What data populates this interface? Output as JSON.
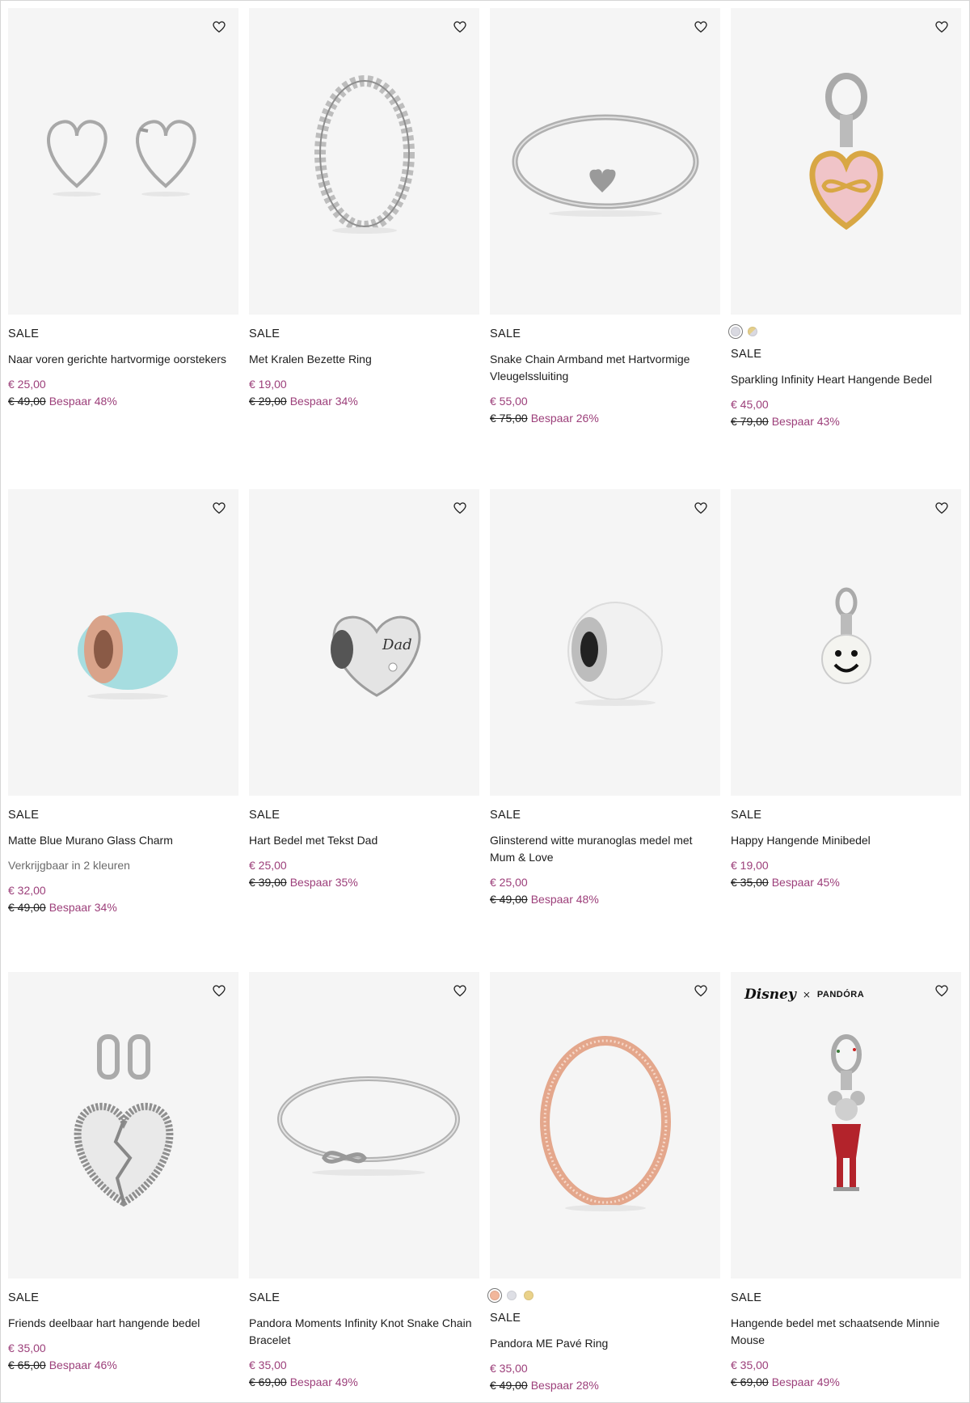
{
  "products": [
    {
      "badge": "SALE",
      "name": "Naar voren gerichte hartvormige oorstekers",
      "price": "€ 25,00",
      "old_price": "€ 49,00",
      "save": "Bespaar 48%",
      "icon": "heart-earrings"
    },
    {
      "badge": "SALE",
      "name": "Met Kralen Bezette Ring",
      "price": "€ 19,00",
      "old_price": "€ 29,00",
      "save": "Bespaar 34%",
      "icon": "beaded-ring"
    },
    {
      "badge": "SALE",
      "name": "Snake Chain Armband met Hartvormige Vleugelssluiting",
      "price": "€ 55,00",
      "old_price": "€ 75,00",
      "save": "Bespaar 26%",
      "icon": "snake-chain-bracelet"
    },
    {
      "badge": "SALE",
      "name": "Sparkling Infinity Heart Hangende Bedel",
      "price": "€ 45,00",
      "old_price": "€ 79,00",
      "save": "Bespaar 43%",
      "icon": "infinity-heart-dangle",
      "swatches": [
        "#d9d9e1",
        "#e5cf8a"
      ]
    },
    {
      "badge": "SALE",
      "name": "Matte Blue Murano Glass Charm",
      "availability": "Verkrijgbaar in 2 kleuren",
      "price": "€ 32,00",
      "old_price": "€ 49,00",
      "save": "Bespaar 34%",
      "icon": "murano-charm"
    },
    {
      "badge": "SALE",
      "name": "Hart Bedel met Tekst Dad",
      "price": "€ 25,00",
      "old_price": "€ 39,00",
      "save": "Bespaar 35%",
      "icon": "dad-heart-charm",
      "engraving": "Dad"
    },
    {
      "badge": "SALE",
      "name": "Glinsterend witte muranoglas medel met Mum & Love",
      "price": "€ 25,00",
      "old_price": "€ 49,00",
      "save": "Bespaar 48%",
      "icon": "white-murano-charm"
    },
    {
      "badge": "SALE",
      "name": "Happy Hangende Minibedel",
      "price": "€ 19,00",
      "old_price": "€ 35,00",
      "save": "Bespaar 45%",
      "icon": "smiley-dangle"
    },
    {
      "badge": "SALE",
      "name": "Friends deelbaar hart hangende bedel",
      "price": "€ 35,00",
      "old_price": "€ 65,00",
      "save": "Bespaar 46%",
      "icon": "split-heart-dangle"
    },
    {
      "badge": "SALE",
      "name": "Pandora Moments Infinity Knot Snake Chain Bracelet",
      "price": "€ 35,00",
      "old_price": "€ 69,00",
      "save": "Bespaar 49%",
      "icon": "infinity-bracelet"
    },
    {
      "badge": "SALE",
      "name": "Pandora ME Pavé Ring",
      "price": "€ 35,00",
      "old_price": "€ 49,00",
      "save": "Bespaar 28%",
      "icon": "rose-pave-ring",
      "swatches": [
        "#f2b79b",
        "#dedfe5",
        "#ead28a"
      ]
    },
    {
      "badge": "SALE",
      "name": "Hangende bedel met schaatsende Minnie Mouse",
      "price": "€ 35,00",
      "old_price": "€ 69,00",
      "save": "Bespaar 49%",
      "icon": "minnie-dangle",
      "brand": {
        "left": "Disney",
        "x": "×",
        "right": "PANDÓRA"
      }
    }
  ],
  "icons": {
    "wishlist": "heart-outline-icon"
  },
  "colors": {
    "sale_price": "#9c3f7a",
    "tile_bg": "#f5f5f5"
  }
}
